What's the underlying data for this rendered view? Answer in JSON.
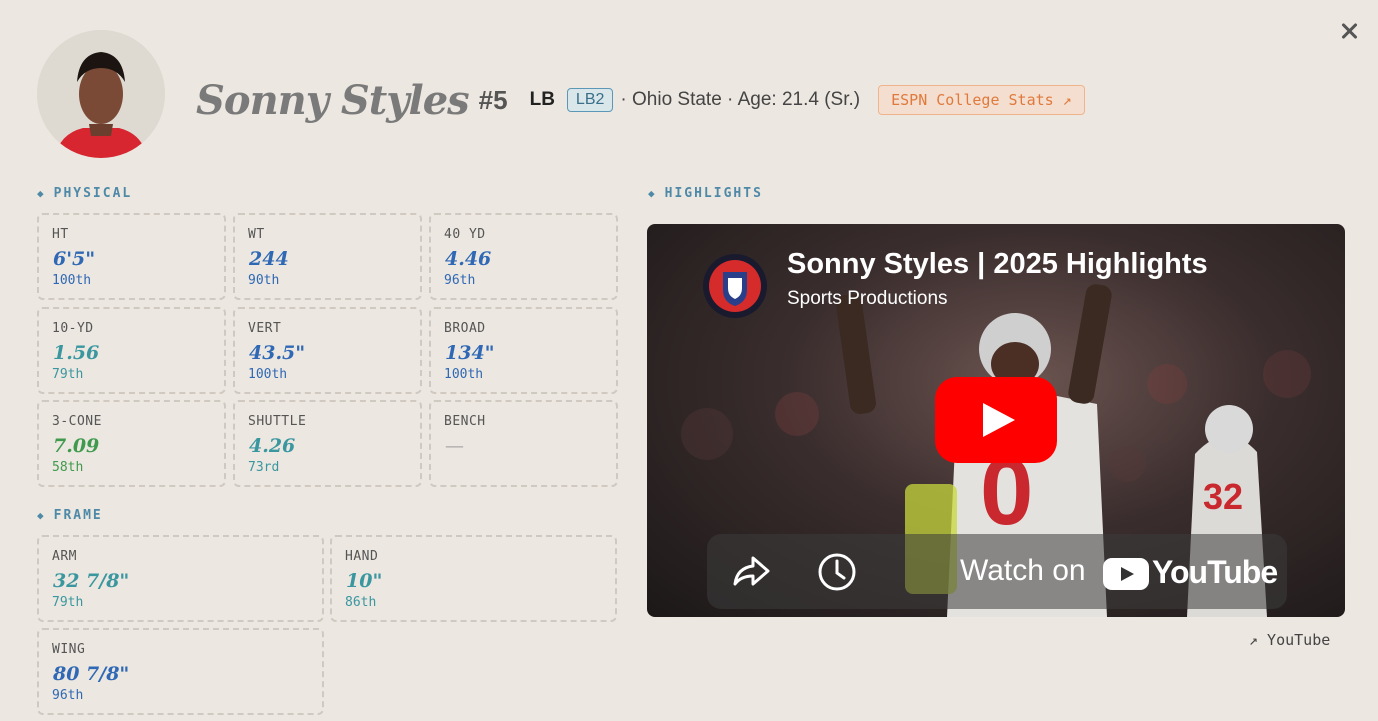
{
  "header": {
    "name": "Sonny Styles",
    "number": "#5",
    "position": "LB",
    "badge": "LB2",
    "meta": "· Ohio State · Age: 21.4 (Sr.)",
    "espn_link": "ESPN College Stats ↗"
  },
  "sections": {
    "physical": "PHYSICAL",
    "frame": "FRAME",
    "highlights": "HIGHLIGHTS",
    "bullet": "◆"
  },
  "physical": [
    {
      "label": "HT",
      "value": "6'5\"",
      "percentile": "100th",
      "tone": "blue"
    },
    {
      "label": "WT",
      "value": "244",
      "percentile": "90th",
      "tone": "blue"
    },
    {
      "label": "40 YD",
      "value": "4.46",
      "percentile": "96th",
      "tone": "blue"
    },
    {
      "label": "10-YD",
      "value": "1.56",
      "percentile": "79th",
      "tone": "teal"
    },
    {
      "label": "VERT",
      "value": "43.5\"",
      "percentile": "100th",
      "tone": "blue"
    },
    {
      "label": "BROAD",
      "value": "134\"",
      "percentile": "100th",
      "tone": "blue"
    },
    {
      "label": "3-CONE",
      "value": "7.09",
      "percentile": "58th",
      "tone": "green"
    },
    {
      "label": "SHUTTLE",
      "value": "4.26",
      "percentile": "73rd",
      "tone": "teal"
    },
    {
      "label": "BENCH",
      "value": "—",
      "percentile": "",
      "tone": "gray"
    }
  ],
  "frame": [
    {
      "label": "ARM",
      "value": "32 7/8\"",
      "percentile": "79th",
      "tone": "teal"
    },
    {
      "label": "HAND",
      "value": "10\"",
      "percentile": "86th",
      "tone": "teal"
    },
    {
      "label": "WING",
      "value": "80 7/8\"",
      "percentile": "96th",
      "tone": "blue"
    }
  ],
  "video": {
    "title": "Sonny Styles | 2025 Highlights",
    "channel": "Sports Productions",
    "watch_on": "Watch on",
    "youtube": "YouTube",
    "jersey_number": "0",
    "jersey_number_2": "32"
  },
  "youtube_link": "↗ YouTube",
  "icons": [
    "close-icon",
    "share-icon",
    "clock-icon",
    "play-icon",
    "youtube-logo-icon",
    "channel-logo-icon"
  ],
  "colors": {
    "background": "#ece7e0",
    "accent_blue": "#2f68b5",
    "accent_green": "#3f9a4d",
    "accent_teal": "#3a97a0",
    "espn_orange": "#e07a3c",
    "youtube_red": "#ff0000"
  }
}
